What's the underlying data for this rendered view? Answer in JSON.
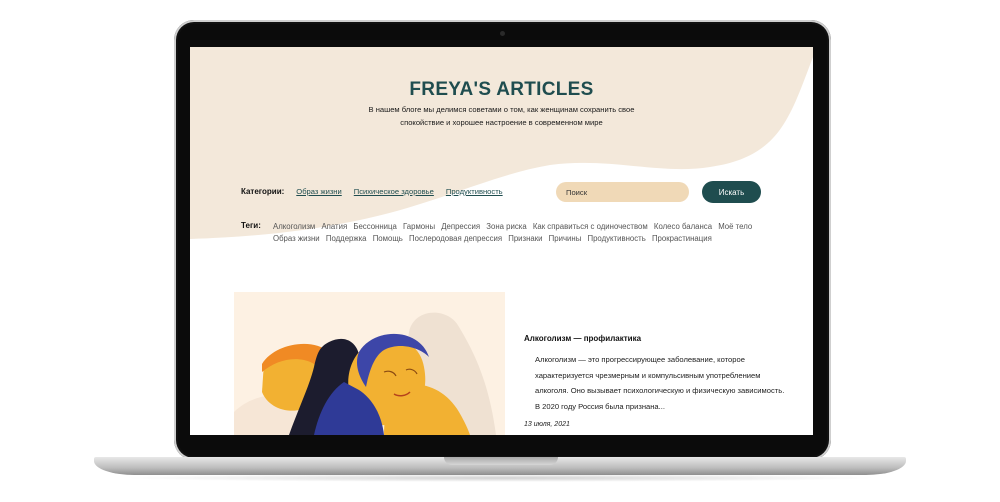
{
  "header": {
    "title": "FREYA'S ARTICLES",
    "subtitle": "В нашем блоге мы делимся советами о том, как женщинам сохранить свое спокойствие и хорошее настроение в современном мире"
  },
  "categories": {
    "label": "Категории:",
    "items": [
      "Образ жизни",
      "Психическое здоровье",
      "Продуктивность"
    ]
  },
  "search": {
    "placeholder": "Поиск",
    "button_label": "Искать"
  },
  "tags": {
    "label": "Теги:",
    "items": [
      "Алкоголизм",
      "Апатия",
      "Бессонница",
      "Гармоны",
      "Депрессия",
      "Зона риска",
      "Как справиться с одиночеством",
      "Колесо баланса",
      "Моё тело",
      "Образ жизни",
      "Поддержка",
      "Помощь",
      "Послеродовая депрессия",
      "Признаки",
      "Причины",
      "Продуктивность",
      "Прокрастинация"
    ]
  },
  "article": {
    "title": "Алкоголизм — профилактика",
    "excerpt": "Алкоголизм — это прогрессирующее заболевание, которое характеризуется чрезмерным и компульсивным употреблением алкоголя. Оно вызывает психологическую и физическую зависимость. В 2020 году Россия была признана...",
    "date": "13 июля, 2021"
  },
  "colors": {
    "accent": "#1f4d4f",
    "hero_bg": "#f3e8da",
    "search_bg": "#f0d9b7"
  }
}
